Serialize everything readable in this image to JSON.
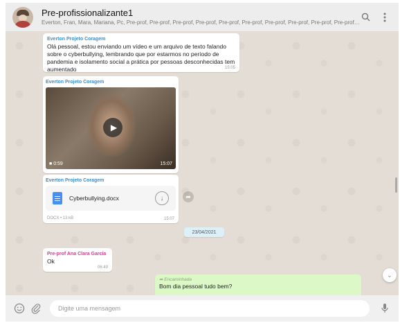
{
  "header": {
    "title": "Pre-profissionalizante1",
    "participants": "Everton, Fran, Mara, Mariana, Pc, Pre-prof, Pre-prof, Pre-prof, Pre-prof, Pre-prof, Pre-prof, Pre-prof, Pre-prof, Pre-prof, Pre-prof, Pre-prof, Pre-prof..."
  },
  "icons": {
    "search": "search-icon",
    "menu": "more-vertical-icon",
    "emoji": "emoji-icon",
    "attach": "paperclip-icon",
    "mic": "microphone-icon"
  },
  "messages": [
    {
      "sender": "Everton Projeto Coragem",
      "text": "Olá pessoal, estou enviando um vídeo e um arquivo de texto falando sobre o cyberbullying, lembrando que por estarmos no período de pandemia e isolamento social a prática por pessoas desconhecidas tem aumentado",
      "time": "15:05"
    },
    {
      "sender": "Everton Projeto Coragem",
      "video_duration": "0:59",
      "time": "15:07"
    },
    {
      "sender": "Everton Projeto Coragem",
      "file_name": "Cyberbullying.docx",
      "file_meta": "DOCX • 13 kB",
      "time": "15:07"
    },
    {
      "sender": "Pre-prof Ana Clara Garcia",
      "text": "Ok",
      "time": "06:49"
    },
    {
      "forwarded_label": "Encaminhada",
      "text": "Bom dia pessoal tudo bem?"
    }
  ],
  "date_separator": "23/04/2021",
  "composer": {
    "placeholder": "Digite uma mensagem"
  },
  "colors": {
    "chat_bg": "#e4ddd5",
    "outgoing_bubble": "#dcf8c6",
    "sender_blue": "#3a8fd0",
    "sender_pink": "#d1408d",
    "header_bg": "#ededed"
  }
}
